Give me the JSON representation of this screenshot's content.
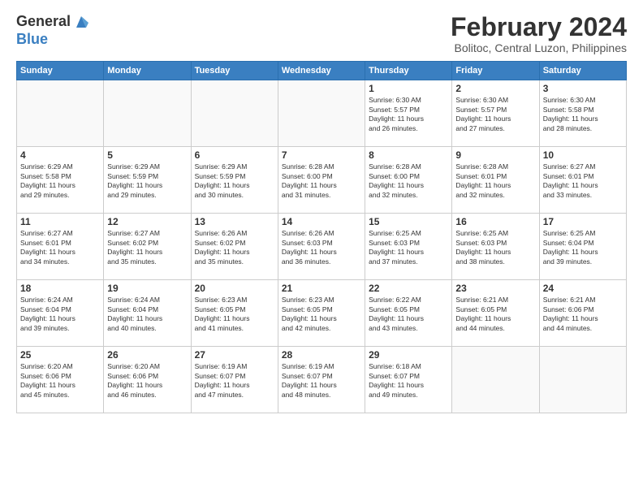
{
  "header": {
    "logo_line1": "General",
    "logo_line2": "Blue",
    "month_title": "February 2024",
    "subtitle": "Bolitoc, Central Luzon, Philippines"
  },
  "weekdays": [
    "Sunday",
    "Monday",
    "Tuesday",
    "Wednesday",
    "Thursday",
    "Friday",
    "Saturday"
  ],
  "weeks": [
    [
      {
        "day": "",
        "info": ""
      },
      {
        "day": "",
        "info": ""
      },
      {
        "day": "",
        "info": ""
      },
      {
        "day": "",
        "info": ""
      },
      {
        "day": "1",
        "info": "Sunrise: 6:30 AM\nSunset: 5:57 PM\nDaylight: 11 hours\nand 26 minutes."
      },
      {
        "day": "2",
        "info": "Sunrise: 6:30 AM\nSunset: 5:57 PM\nDaylight: 11 hours\nand 27 minutes."
      },
      {
        "day": "3",
        "info": "Sunrise: 6:30 AM\nSunset: 5:58 PM\nDaylight: 11 hours\nand 28 minutes."
      }
    ],
    [
      {
        "day": "4",
        "info": "Sunrise: 6:29 AM\nSunset: 5:58 PM\nDaylight: 11 hours\nand 29 minutes."
      },
      {
        "day": "5",
        "info": "Sunrise: 6:29 AM\nSunset: 5:59 PM\nDaylight: 11 hours\nand 29 minutes."
      },
      {
        "day": "6",
        "info": "Sunrise: 6:29 AM\nSunset: 5:59 PM\nDaylight: 11 hours\nand 30 minutes."
      },
      {
        "day": "7",
        "info": "Sunrise: 6:28 AM\nSunset: 6:00 PM\nDaylight: 11 hours\nand 31 minutes."
      },
      {
        "day": "8",
        "info": "Sunrise: 6:28 AM\nSunset: 6:00 PM\nDaylight: 11 hours\nand 32 minutes."
      },
      {
        "day": "9",
        "info": "Sunrise: 6:28 AM\nSunset: 6:01 PM\nDaylight: 11 hours\nand 32 minutes."
      },
      {
        "day": "10",
        "info": "Sunrise: 6:27 AM\nSunset: 6:01 PM\nDaylight: 11 hours\nand 33 minutes."
      }
    ],
    [
      {
        "day": "11",
        "info": "Sunrise: 6:27 AM\nSunset: 6:01 PM\nDaylight: 11 hours\nand 34 minutes."
      },
      {
        "day": "12",
        "info": "Sunrise: 6:27 AM\nSunset: 6:02 PM\nDaylight: 11 hours\nand 35 minutes."
      },
      {
        "day": "13",
        "info": "Sunrise: 6:26 AM\nSunset: 6:02 PM\nDaylight: 11 hours\nand 35 minutes."
      },
      {
        "day": "14",
        "info": "Sunrise: 6:26 AM\nSunset: 6:03 PM\nDaylight: 11 hours\nand 36 minutes."
      },
      {
        "day": "15",
        "info": "Sunrise: 6:25 AM\nSunset: 6:03 PM\nDaylight: 11 hours\nand 37 minutes."
      },
      {
        "day": "16",
        "info": "Sunrise: 6:25 AM\nSunset: 6:03 PM\nDaylight: 11 hours\nand 38 minutes."
      },
      {
        "day": "17",
        "info": "Sunrise: 6:25 AM\nSunset: 6:04 PM\nDaylight: 11 hours\nand 39 minutes."
      }
    ],
    [
      {
        "day": "18",
        "info": "Sunrise: 6:24 AM\nSunset: 6:04 PM\nDaylight: 11 hours\nand 39 minutes."
      },
      {
        "day": "19",
        "info": "Sunrise: 6:24 AM\nSunset: 6:04 PM\nDaylight: 11 hours\nand 40 minutes."
      },
      {
        "day": "20",
        "info": "Sunrise: 6:23 AM\nSunset: 6:05 PM\nDaylight: 11 hours\nand 41 minutes."
      },
      {
        "day": "21",
        "info": "Sunrise: 6:23 AM\nSunset: 6:05 PM\nDaylight: 11 hours\nand 42 minutes."
      },
      {
        "day": "22",
        "info": "Sunrise: 6:22 AM\nSunset: 6:05 PM\nDaylight: 11 hours\nand 43 minutes."
      },
      {
        "day": "23",
        "info": "Sunrise: 6:21 AM\nSunset: 6:05 PM\nDaylight: 11 hours\nand 44 minutes."
      },
      {
        "day": "24",
        "info": "Sunrise: 6:21 AM\nSunset: 6:06 PM\nDaylight: 11 hours\nand 44 minutes."
      }
    ],
    [
      {
        "day": "25",
        "info": "Sunrise: 6:20 AM\nSunset: 6:06 PM\nDaylight: 11 hours\nand 45 minutes."
      },
      {
        "day": "26",
        "info": "Sunrise: 6:20 AM\nSunset: 6:06 PM\nDaylight: 11 hours\nand 46 minutes."
      },
      {
        "day": "27",
        "info": "Sunrise: 6:19 AM\nSunset: 6:07 PM\nDaylight: 11 hours\nand 47 minutes."
      },
      {
        "day": "28",
        "info": "Sunrise: 6:19 AM\nSunset: 6:07 PM\nDaylight: 11 hours\nand 48 minutes."
      },
      {
        "day": "29",
        "info": "Sunrise: 6:18 AM\nSunset: 6:07 PM\nDaylight: 11 hours\nand 49 minutes."
      },
      {
        "day": "",
        "info": ""
      },
      {
        "day": "",
        "info": ""
      }
    ]
  ]
}
